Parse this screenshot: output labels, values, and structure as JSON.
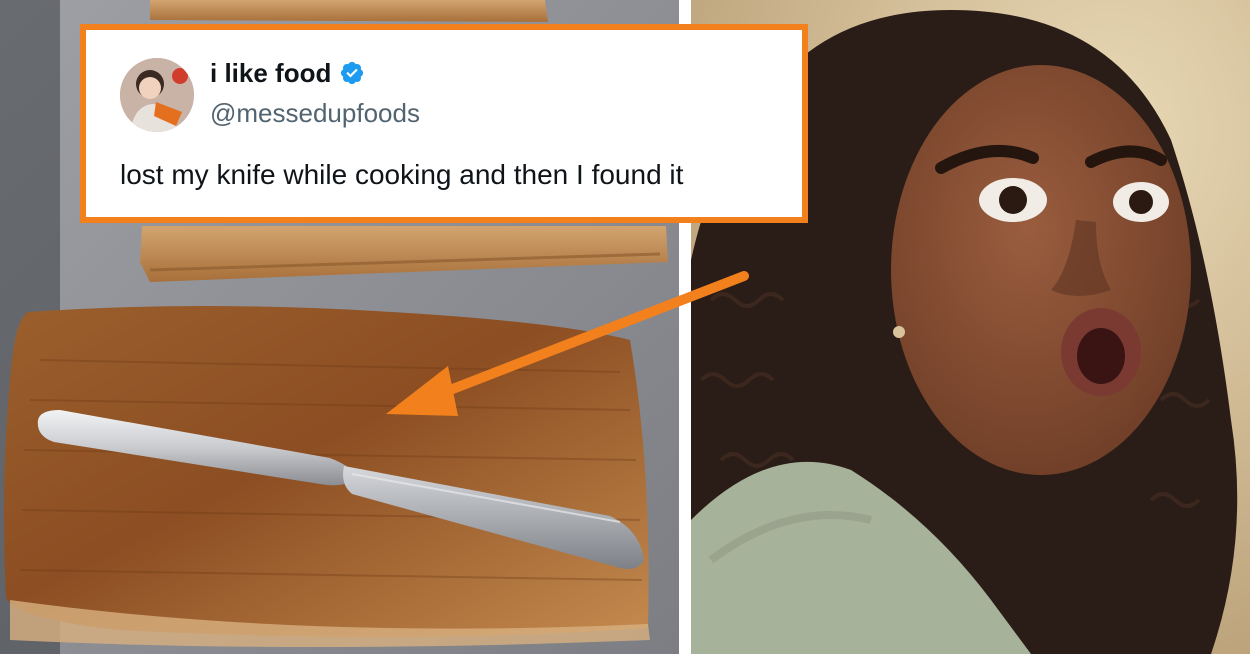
{
  "tweet": {
    "name": "i like food",
    "handle": "@messedupfoods",
    "text": "lost my knife while cooking and then I found it",
    "verified": true
  },
  "colors": {
    "accent_border": "#f2811d",
    "verified_badge": "#1d9bf0"
  },
  "icons": {
    "verified": "verified-badge-icon",
    "avatar": "avatar"
  }
}
